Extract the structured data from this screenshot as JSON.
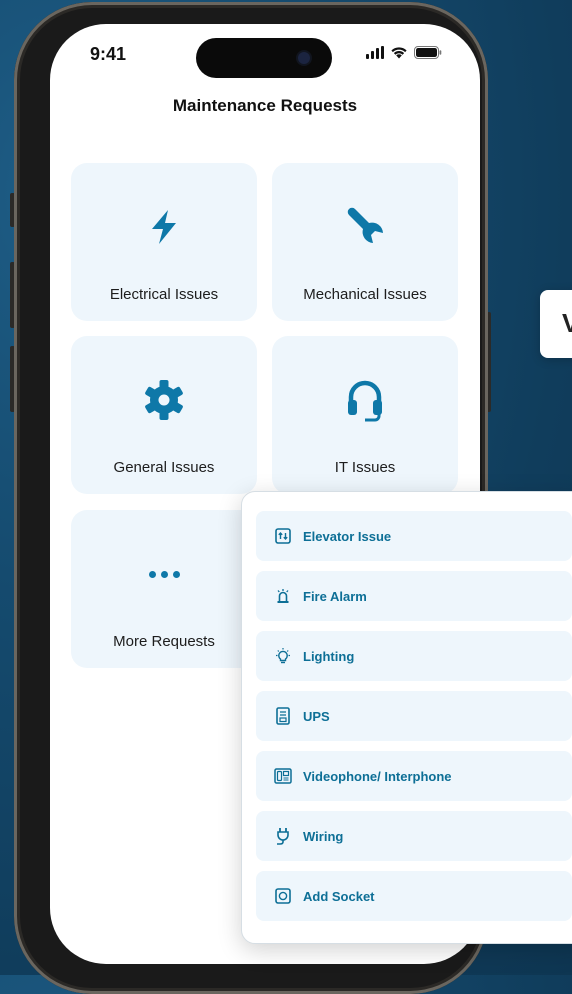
{
  "status": {
    "time": "9:41"
  },
  "header": {
    "title": "Maintenance Requests"
  },
  "categories": [
    {
      "label": "Electrical Issues",
      "icon": "bolt-icon"
    },
    {
      "label": "Mechanical Issues",
      "icon": "wrench-icon"
    },
    {
      "label": "General Issues",
      "icon": "gear-icon"
    },
    {
      "label": "IT Issues",
      "icon": "headset-icon"
    },
    {
      "label": "More Requests",
      "icon": "more-dots-icon"
    }
  ],
  "more_menu": {
    "items": [
      {
        "label": "Elevator Issue",
        "icon": "elevator-icon"
      },
      {
        "label": "Fire Alarm",
        "icon": "siren-icon"
      },
      {
        "label": "Lighting",
        "icon": "lightbulb-icon"
      },
      {
        "label": "UPS",
        "icon": "ups-icon"
      },
      {
        "label": "Videophone/ Interphone",
        "icon": "interphone-icon"
      },
      {
        "label": "Wiring",
        "icon": "plug-icon"
      },
      {
        "label": "Add Socket",
        "icon": "socket-icon"
      }
    ]
  },
  "tooltip": {
    "text": "V"
  },
  "colors": {
    "accent": "#0e78a8",
    "tile_bg": "#eef6fc",
    "background": "#124567"
  }
}
